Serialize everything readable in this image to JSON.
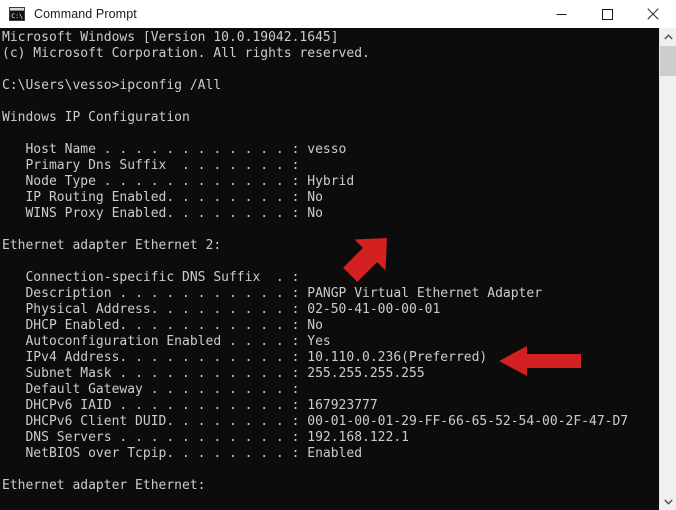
{
  "window": {
    "title": "Command Prompt",
    "icon": "command-prompt-icon",
    "controls": {
      "minimize": "—",
      "maximize": "□",
      "close": "✕"
    },
    "background_color": "#0c0c0c",
    "text_color": "#cccccc",
    "titlebar_color": "#ffffff"
  },
  "console": {
    "lines": [
      "Microsoft Windows [Version 10.0.19042.1645]",
      "(c) Microsoft Corporation. All rights reserved.",
      "",
      "C:\\Users\\vesso>ipconfig /All",
      "",
      "Windows IP Configuration",
      "",
      "   Host Name . . . . . . . . . . . . : vesso",
      "   Primary Dns Suffix  . . . . . . . :",
      "   Node Type . . . . . . . . . . . . : Hybrid",
      "   IP Routing Enabled. . . . . . . . : No",
      "   WINS Proxy Enabled. . . . . . . . : No",
      "",
      "Ethernet adapter Ethernet 2:",
      "",
      "   Connection-specific DNS Suffix  . :",
      "   Description . . . . . . . . . . . : PANGP Virtual Ethernet Adapter",
      "   Physical Address. . . . . . . . . : 02-50-41-00-00-01",
      "   DHCP Enabled. . . . . . . . . . . : No",
      "   Autoconfiguration Enabled . . . . : Yes",
      "   IPv4 Address. . . . . . . . . . . : 10.110.0.236(Preferred)",
      "   Subnet Mask . . . . . . . . . . . : 255.255.255.255",
      "   Default Gateway . . . . . . . . . :",
      "   DHCPv6 IAID . . . . . . . . . . . : 167923777",
      "   DHCPv6 Client DUID. . . . . . . . : 00-01-00-01-29-FF-66-65-52-54-00-2F-47-D7",
      "   DNS Servers . . . . . . . . . . . : 192.168.122.1",
      "   NetBIOS over Tcpip. . . . . . . . : Enabled",
      "",
      "Ethernet adapter Ethernet:"
    ],
    "command": "ipconfig /All",
    "prompt": "C:\\Users\\vesso>",
    "fields": {
      "host_name": "vesso",
      "primary_dns_suffix": "",
      "node_type": "Hybrid",
      "ip_routing_enabled": "No",
      "wins_proxy_enabled": "No",
      "adapter_1": "Ethernet adapter Ethernet 2:",
      "connection_specific_dns_suffix": "",
      "description": "PANGP Virtual Ethernet Adapter",
      "physical_address": "02-50-41-00-00-01",
      "dhcp_enabled": "No",
      "autoconfiguration_enabled": "Yes",
      "ipv4_address": "10.110.0.236(Preferred)",
      "subnet_mask": "255.255.255.255",
      "default_gateway": "",
      "dhcpv6_iaid": "167923777",
      "dhcpv6_client_duid": "00-01-00-01-29-FF-66-65-52-54-00-2F-47-D7",
      "dns_servers": "192.168.122.1",
      "netbios_over_tcpip": "Enabled",
      "adapter_2": "Ethernet adapter Ethernet:"
    }
  },
  "annotations": {
    "color": "#d32020",
    "arrows": [
      {
        "name": "arrow-pointing-to-dns-suffix",
        "direction": "down-left",
        "target": "Connection-specific DNS Suffix"
      },
      {
        "name": "arrow-pointing-to-ipv4-address",
        "direction": "left",
        "target": "10.110.0.236(Preferred)"
      }
    ]
  },
  "scrollbar": {
    "up_arrow": "⌃",
    "down_arrow": "⌄",
    "thumb_position": "near-top"
  }
}
